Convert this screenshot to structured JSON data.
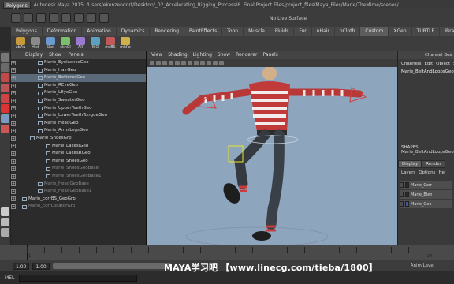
{
  "titlebar": {
    "menu_set": "Polygons",
    "title": "Autodesk Maya 2015: /Users/ekunzendorf/Desktop/_02_Accelerating_Rigging_Process/6. Final Project Files/project_files/Maya_Files/Marie/TheMime/scenes/",
    "live_surface": "No Live Surface"
  },
  "shelf_tabs": [
    "Polygons",
    "Deformation",
    "Animation",
    "Dynamics",
    "Rendering",
    "PaintEffects",
    "Toon",
    "Muscle",
    "Fluids",
    "Fur",
    "nHair",
    "nCloth",
    "Custom",
    "XGen",
    "TURTLE",
    "IBrau"
  ],
  "shelf_tab_active": "Custom",
  "shelf_buttons": [
    {
      "label": "abAu",
      "color": "#c89a3a"
    },
    {
      "label": "Hist",
      "color": "#8a8a8a"
    },
    {
      "label": "Skel",
      "color": "#6a9ad0"
    },
    {
      "label": "sknCl",
      "color": "#7ac06a"
    },
    {
      "label": "All",
      "color": "#9a7ad0"
    },
    {
      "label": "ISO",
      "color": "#5aa0c0"
    },
    {
      "label": "mrBS",
      "color": "#c05a5a"
    },
    {
      "label": "mkPo",
      "color": "#d0b04a"
    }
  ],
  "outliner": {
    "menu": [
      "Display",
      "Show",
      "Panels"
    ],
    "rows": [
      {
        "label": "Marie_EyelashesGeo",
        "indent": 2,
        "state": "normal"
      },
      {
        "label": "Marie_HairGeo",
        "indent": 2,
        "state": "normal"
      },
      {
        "label": "Marie_BottomsGeo",
        "indent": 2,
        "state": "selected"
      },
      {
        "label": "Marie_REyeGeo",
        "indent": 2,
        "state": "normal"
      },
      {
        "label": "Marie_LEyeGeo",
        "indent": 2,
        "state": "normal"
      },
      {
        "label": "Marie_SweaterGeo",
        "indent": 2,
        "state": "normal"
      },
      {
        "label": "Marie_UpperTeethGeo",
        "indent": 2,
        "state": "normal"
      },
      {
        "label": "Marie_LowerTeethTongueGeo",
        "indent": 2,
        "state": "normal"
      },
      {
        "label": "Marie_HeadGeo",
        "indent": 2,
        "state": "normal"
      },
      {
        "label": "Marie_ArmsLegsGeo",
        "indent": 2,
        "state": "normal"
      },
      {
        "label": "Marie_ShoesGrp",
        "indent": 1,
        "state": "normal"
      },
      {
        "label": "Marie_LaceslGeo",
        "indent": 3,
        "state": "normal"
      },
      {
        "label": "Marie_LacesRGeo",
        "indent": 3,
        "state": "normal"
      },
      {
        "label": "Marie_ShoesGeo",
        "indent": 3,
        "state": "normal"
      },
      {
        "label": "Marie_ShoesGeoBase",
        "indent": 3,
        "state": "dim"
      },
      {
        "label": "Marie_ShoesGeoBase1",
        "indent": 3,
        "state": "dim"
      },
      {
        "label": "Marie_HeadGeoBase",
        "indent": 2,
        "state": "dim"
      },
      {
        "label": "Marie_HeadGeoBase1",
        "indent": 2,
        "state": "dim"
      },
      {
        "label": "Marie_corrBS_GeoGrp",
        "indent": 0,
        "state": "normal"
      },
      {
        "label": "Marie_corrLocatorGrp",
        "indent": 0,
        "state": "dim"
      }
    ]
  },
  "viewport": {
    "menu": [
      "View",
      "Shading",
      "Lighting",
      "Show",
      "Renderer",
      "Panels"
    ]
  },
  "channel_box": {
    "header": "Channel Box",
    "menu": [
      "Channels",
      "Edit",
      "Object",
      "Show"
    ],
    "object_name": "Marie_BeltAndLoopsGeo",
    "shapes_label": "SHAPES",
    "shape_name": "Marie_BeltAndLoopsGeo",
    "layer_tabs": [
      "Display",
      "Render"
    ],
    "layer_tab_active": "Display",
    "layer_menu": [
      "Layers",
      "Options",
      "He"
    ],
    "layers": [
      {
        "label": "Marie_Corr",
        "color": "#2a2a2a"
      },
      {
        "label": "Marie_Blen",
        "color": "#2a2a2a"
      },
      {
        "label": "Marie_Geo",
        "color": "#3a5aa0"
      }
    ]
  },
  "time_slider": {
    "ticks": [
      "1",
      "",
      "",
      "",
      "",
      "",
      "",
      "",
      "",
      "",
      "",
      "",
      "",
      "",
      "",
      "",
      "",
      "",
      "",
      "",
      "",
      "",
      "",
      "24"
    ],
    "current_frame": "1"
  },
  "range_slider": {
    "start": "1.00",
    "start2": "1.00",
    "anim_layer": "Anim Laye"
  },
  "command_line": {
    "lang": "MEL"
  },
  "watermark": "MAYA学习吧   【www.linecg.com/tieba/1800】"
}
